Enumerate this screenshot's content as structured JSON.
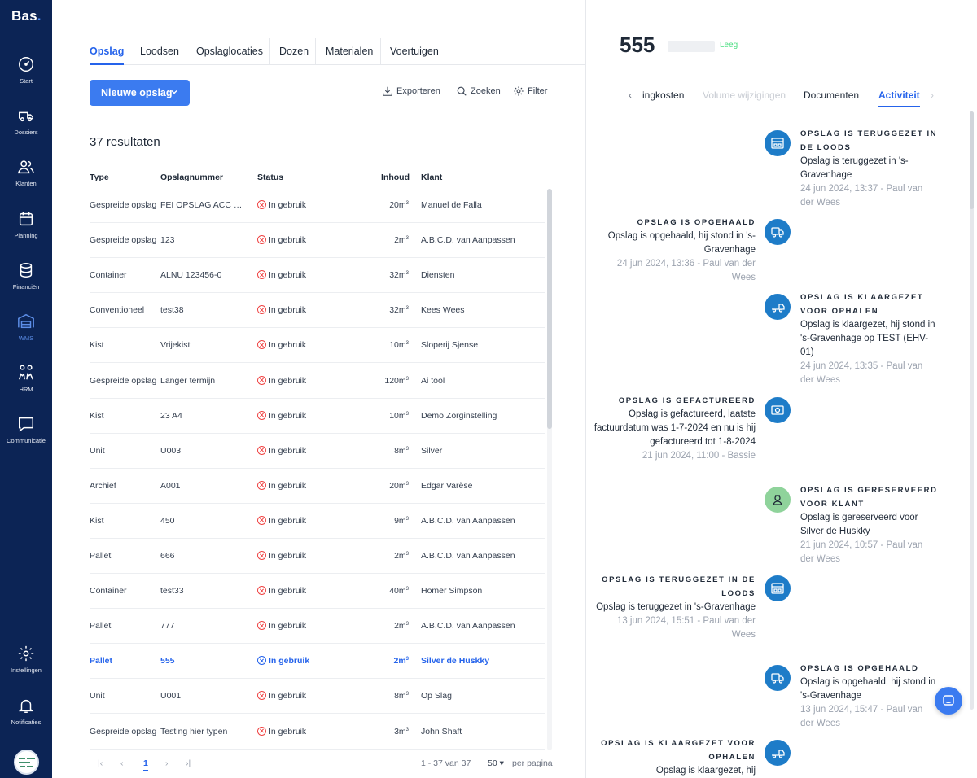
{
  "app": {
    "logo": "Bas",
    "logo_dot": "."
  },
  "sidebar": {
    "items": [
      {
        "label": "Start",
        "icon": "gauge-icon"
      },
      {
        "label": "Dossiers",
        "icon": "truck-icon"
      },
      {
        "label": "Klanten",
        "icon": "users-icon"
      },
      {
        "label": "Planning",
        "icon": "calendar-icon"
      },
      {
        "label": "Financiën",
        "icon": "coins-icon"
      },
      {
        "label": "WMS",
        "icon": "warehouse-icon",
        "active": true
      },
      {
        "label": "HRM",
        "icon": "people-icon"
      },
      {
        "label": "Communicatie",
        "icon": "chat-icon"
      }
    ],
    "bottom": [
      {
        "label": "Instellingen",
        "icon": "gear-icon"
      },
      {
        "label": "Notificaties",
        "icon": "bell-icon"
      }
    ]
  },
  "tabs": [
    "Opslag",
    "Loodsen",
    "Opslaglocaties",
    "Dozen",
    "Materialen",
    "Voertuigen"
  ],
  "toolbar": {
    "new_label": "Nieuwe opslag",
    "export_label": "Exporteren",
    "search_label": "Zoeken",
    "filter_label": "Filter"
  },
  "results_label": "37 resultaten",
  "table": {
    "headers": [
      "Type",
      "Opslagnummer",
      "Status",
      "Inhoud",
      "Klant"
    ],
    "unit": "m",
    "unit_sup": "3",
    "rows": [
      {
        "type": "Gespreide opslag",
        "num": "FEI OPSLAG ACC 167...",
        "status": "In gebruik",
        "inhoud": "20",
        "klant": "Manuel de Falla"
      },
      {
        "type": "Gespreide opslag",
        "num": "123",
        "status": "In gebruik",
        "inhoud": "2",
        "klant": "A.B.C.D. van Aanpassen"
      },
      {
        "type": "Container",
        "num": "ALNU 123456-0",
        "status": "In gebruik",
        "inhoud": "32",
        "klant": "Diensten"
      },
      {
        "type": "Conventioneel",
        "num": "test38",
        "status": "In gebruik",
        "inhoud": "32",
        "klant": "Kees Wees"
      },
      {
        "type": "Kist",
        "num": "Vrijekist",
        "status": "In gebruik",
        "inhoud": "10",
        "klant": "Sloperij Sjense"
      },
      {
        "type": "Gespreide opslag",
        "num": "Langer termijn",
        "status": "In gebruik",
        "inhoud": "120",
        "klant": "Ai tool"
      },
      {
        "type": "Kist",
        "num": "23 A4",
        "status": "In gebruik",
        "inhoud": "10",
        "klant": "Demo Zorginstelling"
      },
      {
        "type": "Unit",
        "num": "U003",
        "status": "In gebruik",
        "inhoud": "8",
        "klant": "Silver"
      },
      {
        "type": "Archief",
        "num": "A001",
        "status": "In gebruik",
        "inhoud": "20",
        "klant": "Edgar Varèse"
      },
      {
        "type": "Kist",
        "num": "450",
        "status": "In gebruik",
        "inhoud": "9",
        "klant": "A.B.C.D. van Aanpassen"
      },
      {
        "type": "Pallet",
        "num": "666",
        "status": "In gebruik",
        "inhoud": "2",
        "klant": "A.B.C.D. van Aanpassen"
      },
      {
        "type": "Container",
        "num": "test33",
        "status": "In gebruik",
        "inhoud": "40",
        "klant": "Homer Simpson"
      },
      {
        "type": "Pallet",
        "num": "777",
        "status": "In gebruik",
        "inhoud": "2",
        "klant": "A.B.C.D. van Aanpassen"
      },
      {
        "type": "Pallet",
        "num": "555",
        "status": "In gebruik",
        "inhoud": "2",
        "klant": "Silver de Huskky",
        "selected": true
      },
      {
        "type": "Unit",
        "num": "U001",
        "status": "In gebruik",
        "inhoud": "8",
        "klant": "Op Slag"
      },
      {
        "type": "Gespreide opslag",
        "num": "Testing hier typen",
        "status": "In gebruik",
        "inhoud": "3",
        "klant": "John Shaft"
      }
    ]
  },
  "pagination": {
    "current_page": "1",
    "range": "1 - 37 van 37",
    "per_page": "50",
    "per_page_label": "per pagina"
  },
  "detail": {
    "title": "555",
    "badge": "Leeg",
    "tabs": [
      "ingkosten",
      "Volume wijzigingen",
      "Documenten",
      "Activiteit"
    ],
    "events": [
      {
        "side": "r",
        "heading": "Opslag is teruggezet in de loods",
        "desc": "Opslag is teruggezet in 's-Gravenhage",
        "meta": "24 jun 2024, 13:37 - Paul van der Wees",
        "icon": "warehouse-icon"
      },
      {
        "side": "l",
        "heading": "Opslag is opgehaald",
        "desc": "Opslag is opgehaald, hij stond in 's-Gravenhage",
        "meta": "24 jun 2024, 13:36 - Paul van der Wees",
        "icon": "truck-icon"
      },
      {
        "side": "r",
        "heading": "Opslag is klaargezet voor ophalen",
        "desc": "Opslag is klaargezet, hij stond in 's-Gravenhage op TEST (EHV-01)",
        "meta": "24 jun 2024, 13:35 - Paul van der Wees",
        "icon": "trolley-icon"
      },
      {
        "side": "l",
        "heading": "Opslag is gefactureerd",
        "desc": "Opslag is gefactureerd, laatste factuurdatum was 1-7-2024 en nu is hij gefactureerd tot 1-8-2024",
        "meta": "21 jun 2024, 11:00 - Bassie",
        "icon": "money-icon"
      },
      {
        "side": "r",
        "heading": "Opslag is gereserveerd voor klant",
        "desc": "Opslag is gereserveerd voor Silver de Huskky",
        "meta": "21 jun 2024, 10:57 - Paul van der Wees",
        "icon": "person-icon"
      },
      {
        "side": "l",
        "heading": "Opslag is teruggezet in de loods",
        "desc": "Opslag is teruggezet in 's-Gravenhage",
        "meta": "13 jun 2024, 15:51 - Paul van der Wees",
        "icon": "warehouse-icon"
      },
      {
        "side": "r",
        "heading": "Opslag is opgehaald",
        "desc": "Opslag is opgehaald, hij stond in 's-Gravenhage",
        "meta": "13 jun 2024, 15:47 - Paul van der Wees",
        "icon": "truck-icon"
      },
      {
        "side": "l",
        "heading": "Opslag is klaargezet voor ophalen",
        "desc": "Opslag is klaargezet, hij",
        "meta": "",
        "icon": "trolley-icon"
      }
    ]
  },
  "colors": {
    "sidebar": "#0c2455",
    "accent": "#2563eb",
    "timeline_icon": "#1e7cc8",
    "status_error": "#ef4444",
    "badge_green": "#4ade80"
  }
}
